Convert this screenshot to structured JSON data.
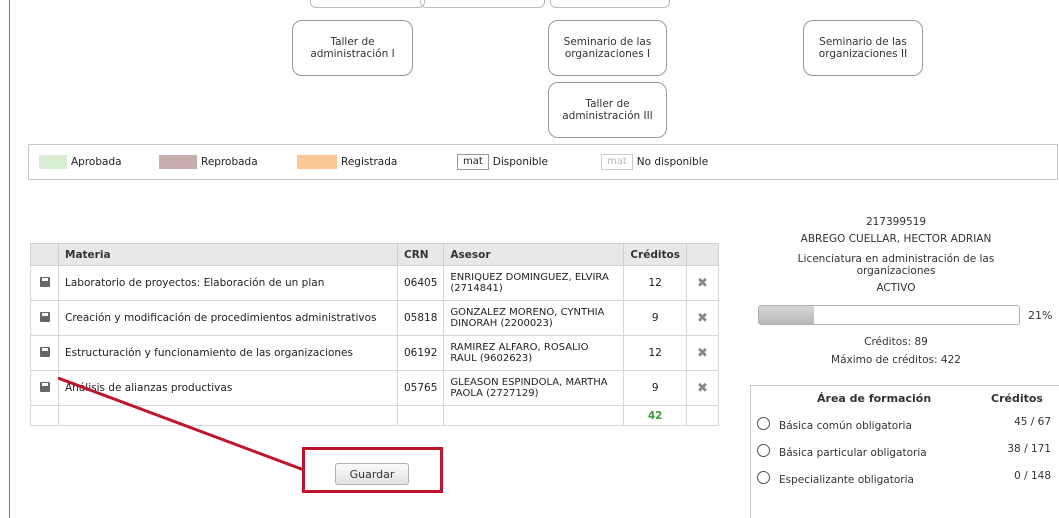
{
  "courses": [
    {
      "line1": "Taller de",
      "line2": "administración I"
    },
    {
      "line1": "Seminario de las",
      "line2": "organizaciones I"
    },
    {
      "line1": "Seminario de las",
      "line2": "organizaciones II"
    },
    {
      "line1": "Taller de",
      "line2": "administración III"
    }
  ],
  "legend": {
    "approved": {
      "label": "Aprobada",
      "color": "#d8edd4"
    },
    "failed": {
      "label": "Reprobada",
      "color": "#c9aeae"
    },
    "registered": {
      "label": "Registrada",
      "color": "#fcc797"
    },
    "available": {
      "tag": "mat",
      "label": "Disponible"
    },
    "unavailable": {
      "tag": "mat",
      "label": "No disponible"
    }
  },
  "table": {
    "headers": {
      "materia": "Materia",
      "crn": "CRN",
      "asesor": "Asesor",
      "creditos": "Créditos"
    },
    "rows": [
      {
        "materia": "Laboratorio de proyectos: Elaboración de un plan",
        "crn": "06405",
        "asesor": "ENRIQUEZ DOMINGUEZ, ELVIRA (2714841)",
        "creditos": "12"
      },
      {
        "materia": "Creación y modificación de procedimientos administrativos",
        "crn": "05818",
        "asesor": "GONZALEZ MORENO, CYNTHIA DINORAH (2200023)",
        "creditos": "9"
      },
      {
        "materia": "Estructuración y funcionamiento de las organizaciones",
        "crn": "06192",
        "asesor": "RAMIREZ ALFARO, ROSALIO RAUL (9602623)",
        "creditos": "12"
      },
      {
        "materia": "Análisis de alianzas productivas",
        "crn": "05765",
        "asesor": "GLEASON ESPINDOLA, MARTHA PAOLA (2727129)",
        "creditos": "9"
      }
    ],
    "total": "42"
  },
  "save_label": "Guardar",
  "student": {
    "id": "217399519",
    "name": "ABREGO CUELLAR, HECTOR ADRIAN",
    "program_line1": "Licenciatura en administración de las",
    "program_line2": "organizaciones",
    "status": "ACTIVO",
    "progress_fraction": 0.21,
    "progress_label": "21%",
    "credits": "Créditos: 89",
    "max_credits": "Máximo de créditos: 422"
  },
  "areas": {
    "head_area": "Área de formación",
    "head_credits": "Créditos",
    "rows": [
      {
        "label": "Básica común obligatoria",
        "value": "45 / 67"
      },
      {
        "label": "Básica particular obligatoria",
        "value": "38 / 171"
      },
      {
        "label": "Especializante obligatoria",
        "value": "0 / 148"
      }
    ]
  },
  "colors": {
    "accent_annotation": "#c0142a",
    "total_credits": "#3a9c3a"
  }
}
